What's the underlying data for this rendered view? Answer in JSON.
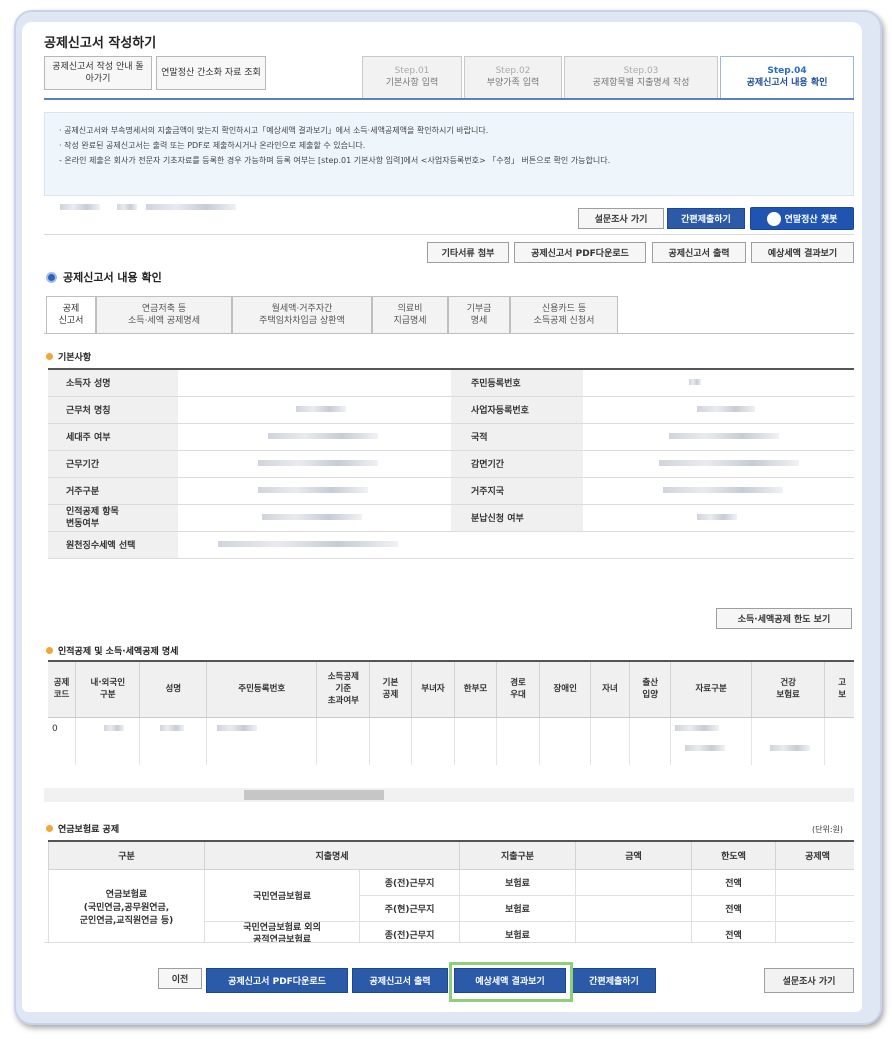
{
  "window": {
    "title": "공제신고서 작성하기"
  },
  "top_buttons": {
    "back_to_guide": "공제신고서 작성 안내 돌아가기",
    "simplified_lookup": "연말정산 간소화 자료 조회"
  },
  "steps": [
    {
      "num": "Step.01",
      "label": "기본사항 입력",
      "active": false
    },
    {
      "num": "Step.02",
      "label": "부양가족 입력",
      "active": false
    },
    {
      "num": "Step.03",
      "label": "공제항목별 지출명세 작성",
      "active": false
    },
    {
      "num": "Step.04",
      "label": "공제신고서 내용 확인",
      "active": true
    }
  ],
  "notice": {
    "line1": "· 공제신고서와 부속명세서의 지출금액이 맞는지 확인하시고「예상세액 결과보기」에서 소득·세액공제액을 확인하시기 바랍니다.",
    "line2": "· 작성 완료된 공제신고서는 출력 또는 PDF로 제출하시거나 온라인으로 제출할 수 있습니다.",
    "line3": "- 온라인 제출은 회사가 전문자 기초자료를 등록한 경우 가능하며 등록 여부는 [step.01 기본사항 입력]에서 <사업자등록번호> 「수정」 버튼으로 확인 가능합니다."
  },
  "action_buttons": {
    "survey": "설문조사 가기",
    "simple_submit": "간편제출하기",
    "chatbot": "연말정산 챗봇",
    "other_docs": "기타서류 첨부",
    "pdf_download": "공제신고서 PDF다운로드",
    "print": "공제신고서 출력",
    "expected_tax": "예상세액 결과보기"
  },
  "section_title": "공제신고서 내용 확인",
  "tabs": [
    {
      "label": "공제\n신고서",
      "active": true
    },
    {
      "label": "연금저축 등\n소득·세액 공제명세",
      "active": false
    },
    {
      "label": "월세액·거주자간\n주택임차차입금 상환액",
      "active": false
    },
    {
      "label": "의료비\n지급명세",
      "active": false
    },
    {
      "label": "기부금\n명세",
      "active": false
    },
    {
      "label": "신용카드 등\n소득공제 신청서",
      "active": false
    }
  ],
  "basic_info": {
    "title": "기본사항",
    "rows": [
      {
        "l": "소득자 성명",
        "r": "주민등록번호"
      },
      {
        "l": "근무처 명칭",
        "r": "사업자등록번호"
      },
      {
        "l": "세대주 여부",
        "r": "국적"
      },
      {
        "l": "근무기간",
        "r": "감면기간"
      },
      {
        "l": "거주구분",
        "r": "거주지국"
      },
      {
        "l": "인적공제 항목\n변동여부",
        "r": "분납신청 여부"
      },
      {
        "l": "원천징수세액 선택",
        "r": ""
      }
    ]
  },
  "ratio_button": "소득·세액공제 한도 보기",
  "deduction_table": {
    "title": "인적공제 및 소득·세액공제 명세",
    "headers": [
      "공제\n코드",
      "내·외국인\n구분",
      "성명",
      "주민등록번호",
      "소득공제\n기준\n초과여부",
      "기본\n공제",
      "부녀자",
      "한부모",
      "경로\n우대",
      "장애인",
      "자녀",
      "출산\n입양",
      "자료구분",
      "건강\n보험료",
      "고\n보"
    ],
    "first_code": "0"
  },
  "pension_table": {
    "title": "연금보험료 공제",
    "unit": "(단위:원)",
    "headers": [
      "구분",
      "지출명세",
      "지출구분",
      "금액",
      "한도액",
      "공제액"
    ],
    "group_label": "연금보험료\n(국민연금,공무원연금,\n군인연금,교직원연금 등)",
    "rows": [
      {
        "sub": "국민연금보험료",
        "who": "종(전)근무지",
        "kind": "보험료",
        "limit": "전액"
      },
      {
        "sub": "",
        "who": "주(현)근무지",
        "kind": "보험료",
        "limit": "전액"
      },
      {
        "sub": "국민연금보험료 외의\n공적연금보험료",
        "who": "종(전)근무지",
        "kind": "보험료",
        "limit": "전액"
      }
    ]
  },
  "bottom_buttons": {
    "prev": "이전",
    "pdf_download": "공제신고서 PDF다운로드",
    "print": "공제신고서 출력",
    "expected_tax": "예상세액 결과보기",
    "simple_submit": "간편제출하기",
    "survey": "설문조사 가기"
  }
}
